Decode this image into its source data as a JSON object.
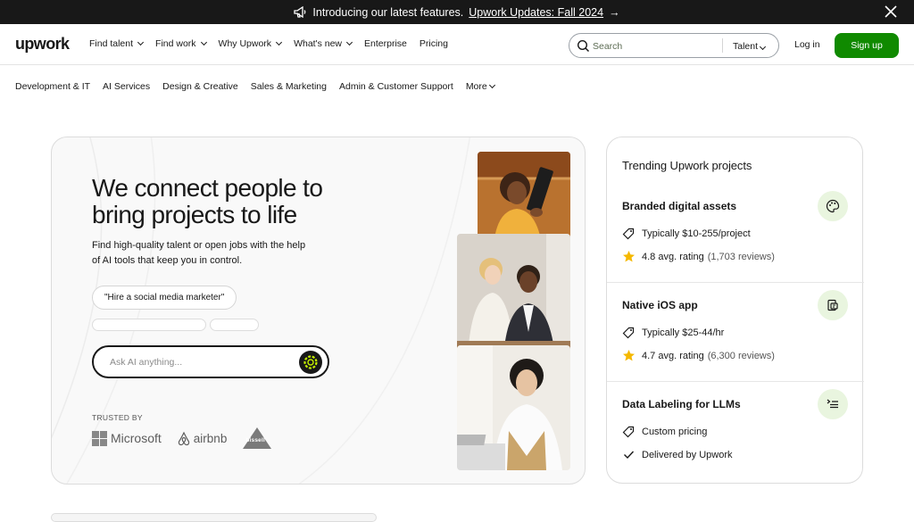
{
  "announcement": {
    "text": "Introducing our latest features.",
    "link": "Upwork Updates: Fall 2024",
    "arrow": "→"
  },
  "header": {
    "logo": "upwork",
    "nav": [
      "Find talent",
      "Find work",
      "Why Upwork",
      "What's new",
      "Enterprise",
      "Pricing"
    ],
    "search": {
      "placeholder": "Search",
      "category": "Talent"
    },
    "login": "Log in",
    "signup": "Sign up"
  },
  "categories": [
    "Development & IT",
    "AI Services",
    "Design & Creative",
    "Sales & Marketing",
    "Admin & Customer Support",
    "More"
  ],
  "hero": {
    "title": "We connect people to bring projects to life",
    "subtitle": "Find high-quality talent or open jobs with the help of AI tools that keep you in control.",
    "chip": "\"Hire a social media marketer\"",
    "ask_placeholder": "Ask AI anything...",
    "trusted_by": "TRUSTED BY",
    "brands": [
      "Microsoft",
      "airbnb",
      "bissell"
    ]
  },
  "trending": {
    "title": "Trending Upwork projects",
    "projects": [
      {
        "title": "Branded digital assets",
        "line1": "Typically $10-255/project",
        "rating": "4.8 avg. rating",
        "reviews": "(1,703 reviews)"
      },
      {
        "title": "Native iOS app",
        "line1": "Typically $25-44/hr",
        "rating": "4.7 avg. rating",
        "reviews": "(6,300 reviews)"
      },
      {
        "title": "Data Labeling for LLMs",
        "line1": "Custom pricing",
        "line2": "Delivered by Upwork"
      }
    ]
  },
  "colors": {
    "brand": "#108a00",
    "dark": "#181818",
    "badge": "#e9f5df",
    "star": "#f5b800",
    "ai_ring": "#c4f000"
  }
}
